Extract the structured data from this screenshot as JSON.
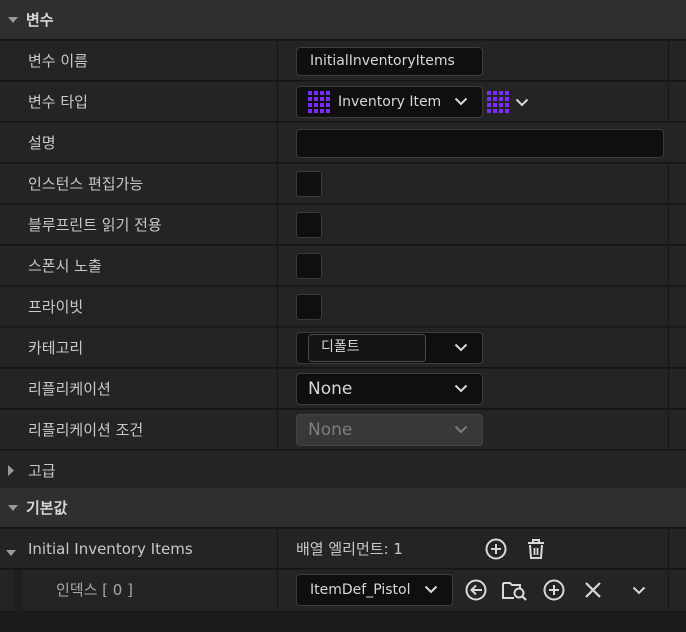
{
  "sections": {
    "variable": {
      "title": "변수"
    },
    "advanced": {
      "title": "고급"
    },
    "defaults": {
      "title": "기본값"
    }
  },
  "fields": {
    "var_name": {
      "label": "변수 이름",
      "value": "InitialInventoryItems"
    },
    "var_type": {
      "label": "변수 타입",
      "value": "Inventory Item"
    },
    "description": {
      "label": "설명",
      "value": ""
    },
    "instance_editable": {
      "label": "인스턴스 편집가능",
      "checked": false
    },
    "bp_readonly": {
      "label": "블루프린트 읽기 전용",
      "checked": false
    },
    "expose_spawn": {
      "label": "스폰시 노출",
      "checked": false
    },
    "private": {
      "label": "프라이빗",
      "checked": false
    },
    "category": {
      "label": "카테고리",
      "value": "디폴트"
    },
    "replication": {
      "label": "리플리케이션",
      "value": "None"
    },
    "replication_condition": {
      "label": "리플리케이션 조건",
      "value": "None"
    }
  },
  "defaults": {
    "array_label": "Initial Inventory Items",
    "array_count": "배열 엘리먼트: 1",
    "index_label": "인덱스 [ 0 ]",
    "index_value": "ItemDef_Pistol"
  },
  "colors": {
    "type_icon": "#7b2bff",
    "panel": "#242424",
    "header": "#2f2f2f"
  },
  "icons": [
    "triangle-down-icon",
    "triangle-right-icon",
    "chevron-down-icon",
    "grid-type-icon",
    "add-circle-icon",
    "trash-icon",
    "use-selected-icon",
    "browse-folder-icon",
    "clear-icon"
  ]
}
